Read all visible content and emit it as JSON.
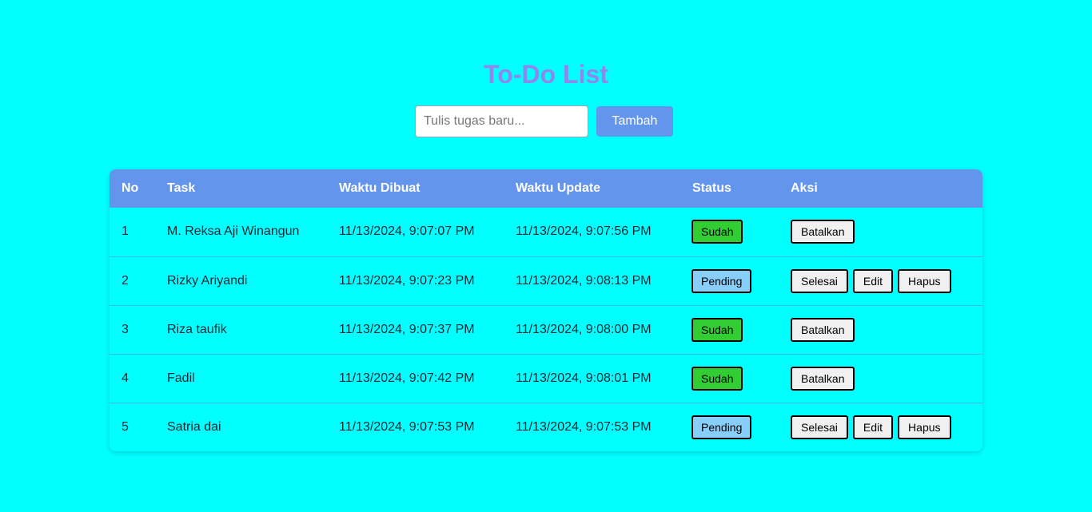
{
  "page": {
    "title": "To-Do List"
  },
  "form": {
    "placeholder": "Tulis tugas baru...",
    "value": "",
    "add_label": "Tambah"
  },
  "table": {
    "headers": [
      "No",
      "Task",
      "Waktu Dibuat",
      "Waktu Update",
      "Status",
      "Aksi"
    ],
    "rows": [
      {
        "no": "1",
        "task": "M. Reksa Aji Winangun",
        "created": "11/13/2024, 9:07:07 PM",
        "updated": "11/13/2024, 9:07:56 PM",
        "status": "Sudah",
        "actions": [
          "Batalkan"
        ]
      },
      {
        "no": "2",
        "task": "Rizky Ariyandi",
        "created": "11/13/2024, 9:07:23 PM",
        "updated": "11/13/2024, 9:08:13 PM",
        "status": "Pending",
        "actions": [
          "Selesai",
          "Edit",
          "Hapus"
        ]
      },
      {
        "no": "3",
        "task": "Riza taufik",
        "created": "11/13/2024, 9:07:37 PM",
        "updated": "11/13/2024, 9:08:00 PM",
        "status": "Sudah",
        "actions": [
          "Batalkan"
        ]
      },
      {
        "no": "4",
        "task": "Fadil",
        "created": "11/13/2024, 9:07:42 PM",
        "updated": "11/13/2024, 9:08:01 PM",
        "status": "Sudah",
        "actions": [
          "Batalkan"
        ]
      },
      {
        "no": "5",
        "task": "Satria dai",
        "created": "11/13/2024, 9:07:53 PM",
        "updated": "11/13/2024, 9:07:53 PM",
        "status": "Pending",
        "actions": [
          "Selesai",
          "Edit",
          "Hapus"
        ]
      }
    ]
  },
  "colors": {
    "background": "#00ffff",
    "title": "#8f86ee",
    "accent": "#6495ed",
    "status_done": "#32cd32",
    "status_pending": "#87cefa"
  }
}
